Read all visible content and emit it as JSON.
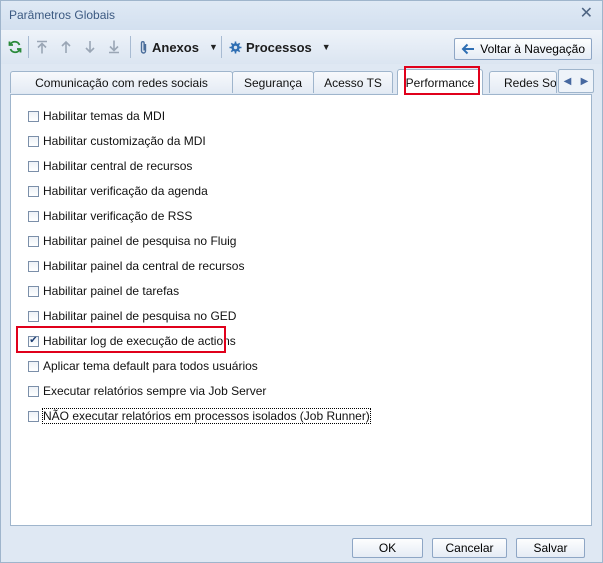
{
  "window": {
    "title": "Parâmetros Globais"
  },
  "toolbar": {
    "attachments_label": "Anexos",
    "processes_label": "Processos",
    "back_label": "Voltar à Navegação"
  },
  "tabs": [
    {
      "label": "Comunicação com redes sociais",
      "active": false
    },
    {
      "label": "Segurança",
      "active": false
    },
    {
      "label": "Acesso TS",
      "active": false
    },
    {
      "label": "Performance",
      "active": true
    },
    {
      "label": "Redes So",
      "active": false
    }
  ],
  "options": [
    {
      "label": "Habilitar temas da MDI",
      "checked": false
    },
    {
      "label": "Habilitar customização da MDI",
      "checked": false
    },
    {
      "label": "Habilitar central de recursos",
      "checked": false
    },
    {
      "label": "Habilitar verificação da agenda",
      "checked": false
    },
    {
      "label": "Habilitar verificação de RSS",
      "checked": false
    },
    {
      "label": "Habilitar painel de pesquisa no Fluig",
      "checked": false
    },
    {
      "label": "Habilitar painel da central de recursos",
      "checked": false
    },
    {
      "label": "Habilitar painel de tarefas",
      "checked": false
    },
    {
      "label": "Habilitar painel de pesquisa no GED",
      "checked": false
    },
    {
      "label": "Habilitar log de execução de actions",
      "checked": true
    },
    {
      "label": "Aplicar tema default para todos usuários",
      "checked": false
    },
    {
      "label": "Executar relatórios sempre via Job Server",
      "checked": false
    },
    {
      "label": "NÃO executar relatórios em processos isolados (Job Runner)",
      "checked": false
    }
  ],
  "footer": {
    "ok_label": "OK",
    "cancel_label": "Cancelar",
    "save_label": "Salvar"
  },
  "colors": {
    "highlight": "#e0001b",
    "title_text": "#3c5a82",
    "panel_border": "#9fb5cc"
  }
}
